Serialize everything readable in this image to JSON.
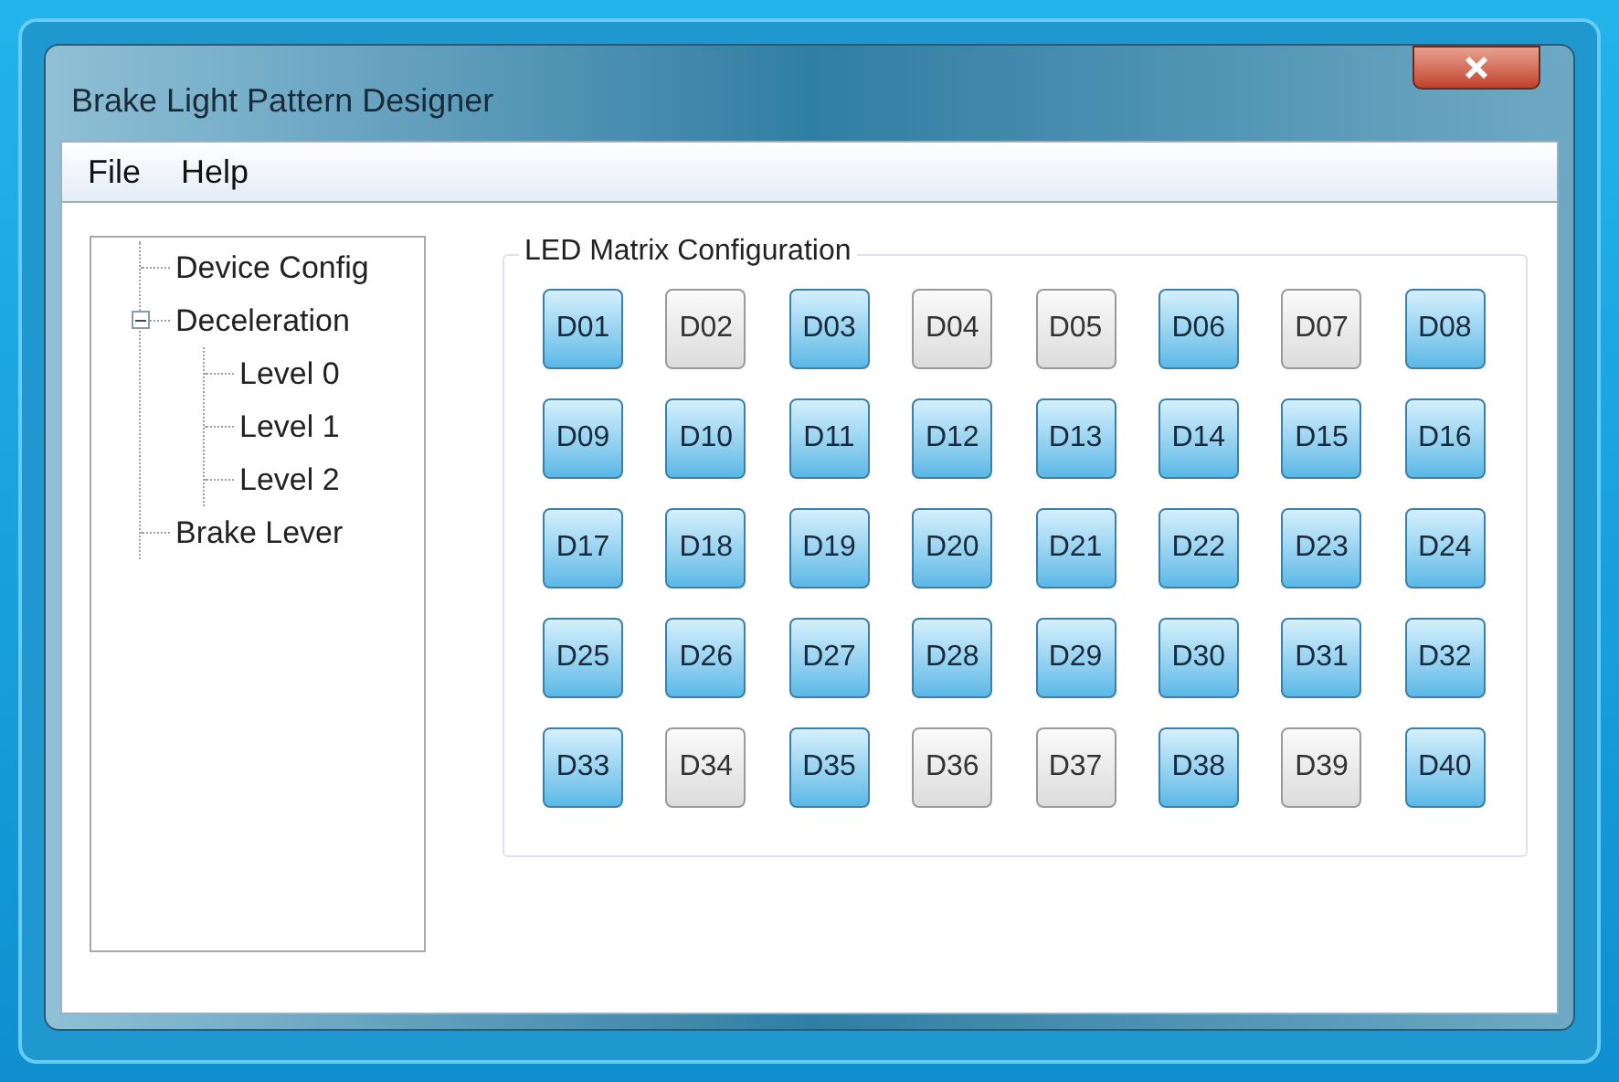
{
  "window": {
    "title": "Brake Light Pattern Designer"
  },
  "menu": [
    "File",
    "Help"
  ],
  "tree": [
    {
      "label": "Device Config"
    },
    {
      "label": "Deceleration",
      "expanded": true,
      "children": [
        {
          "label": "Level 0"
        },
        {
          "label": "Level 1"
        },
        {
          "label": "Level 2"
        }
      ]
    },
    {
      "label": "Brake Lever"
    }
  ],
  "led_matrix": {
    "title": "LED Matrix Configuration",
    "leds": [
      {
        "label": "D01",
        "on": true
      },
      {
        "label": "D02",
        "on": false
      },
      {
        "label": "D03",
        "on": true
      },
      {
        "label": "D04",
        "on": false
      },
      {
        "label": "D05",
        "on": false
      },
      {
        "label": "D06",
        "on": true
      },
      {
        "label": "D07",
        "on": false
      },
      {
        "label": "D08",
        "on": true
      },
      {
        "label": "D09",
        "on": true
      },
      {
        "label": "D10",
        "on": true
      },
      {
        "label": "D11",
        "on": true
      },
      {
        "label": "D12",
        "on": true
      },
      {
        "label": "D13",
        "on": true
      },
      {
        "label": "D14",
        "on": true
      },
      {
        "label": "D15",
        "on": true
      },
      {
        "label": "D16",
        "on": true
      },
      {
        "label": "D17",
        "on": true
      },
      {
        "label": "D18",
        "on": true
      },
      {
        "label": "D19",
        "on": true
      },
      {
        "label": "D20",
        "on": true
      },
      {
        "label": "D21",
        "on": true
      },
      {
        "label": "D22",
        "on": true
      },
      {
        "label": "D23",
        "on": true
      },
      {
        "label": "D24",
        "on": true
      },
      {
        "label": "D25",
        "on": true
      },
      {
        "label": "D26",
        "on": true
      },
      {
        "label": "D27",
        "on": true
      },
      {
        "label": "D28",
        "on": true
      },
      {
        "label": "D29",
        "on": true
      },
      {
        "label": "D30",
        "on": true
      },
      {
        "label": "D31",
        "on": true
      },
      {
        "label": "D32",
        "on": true
      },
      {
        "label": "D33",
        "on": true
      },
      {
        "label": "D34",
        "on": false
      },
      {
        "label": "D35",
        "on": true
      },
      {
        "label": "D36",
        "on": false
      },
      {
        "label": "D37",
        "on": false
      },
      {
        "label": "D38",
        "on": true
      },
      {
        "label": "D39",
        "on": false
      },
      {
        "label": "D40",
        "on": true
      }
    ]
  }
}
